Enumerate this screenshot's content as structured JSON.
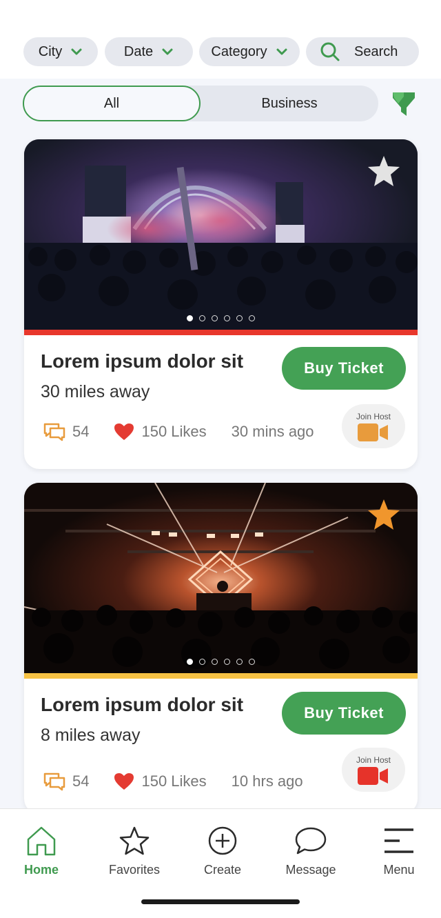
{
  "filters": {
    "city_label": "City",
    "date_label": "Date",
    "category_label": "Category",
    "search_label": "Search"
  },
  "segment": {
    "all_label": "All",
    "business_label": "Business",
    "selected": "All"
  },
  "colors": {
    "brand_green": "#44a155",
    "card1_stripe": "#e8372c",
    "card2_stripe": "#f6c244",
    "star_inactive": "#e3e3e3",
    "star_active": "#f0962d"
  },
  "events": [
    {
      "title": "Lorem ipsum dolor sit",
      "distance": "30 miles away",
      "buy_label": "Buy Ticket",
      "comments": "54",
      "likes": "150 Likes",
      "time": "30 mins ago",
      "host_label": "Join Host",
      "host_icon": "video-camera-icon",
      "host_icon_color": "#e89b3c",
      "favorited": false,
      "image_pages": 6,
      "active_page": 1
    },
    {
      "title": "Lorem ipsum dolor sit",
      "distance": "8 miles away",
      "buy_label": "Buy Ticket",
      "comments": "54",
      "likes": "150 Likes",
      "time": "10 hrs ago",
      "host_label": "Join Host",
      "host_icon": "video-camera-icon",
      "host_icon_color": "#e6332a",
      "favorited": true,
      "image_pages": 6,
      "active_page": 1
    }
  ],
  "nav": {
    "items": [
      {
        "label": "Home",
        "icon": "home-icon",
        "active": true
      },
      {
        "label": "Favorites",
        "icon": "star-icon",
        "active": false
      },
      {
        "label": "Create",
        "icon": "plus-circle-icon",
        "active": false
      },
      {
        "label": "Message",
        "icon": "chat-bubble-icon",
        "active": false
      },
      {
        "label": "Menu",
        "icon": "menu-icon",
        "active": false
      }
    ]
  }
}
